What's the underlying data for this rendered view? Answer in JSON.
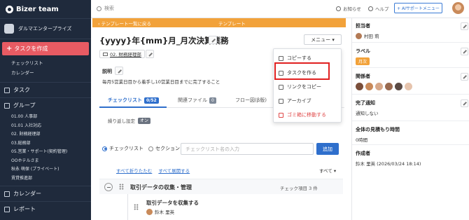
{
  "app": {
    "name": "Bizer team"
  },
  "sidebar": {
    "org_name": "ダルマエンタープライズ",
    "create_task_label": "タスクを作成",
    "sub_items": [
      "チェックリスト",
      "カレンダー"
    ],
    "tasks_label": "タスク",
    "groups_label": "グループ",
    "groups": [
      "01.00 人事部",
      "01.01 入社対応",
      "02. 財務経理部",
      "03.総務部",
      "05.営業・サポート(契約管理)",
      "OOホテルさま",
      "秋永 萌保 (プライベート)",
      "賃貸推進部"
    ],
    "calendar_label": "カレンダー",
    "report_label": "レポート"
  },
  "topbar": {
    "search_placeholder": "検索",
    "notifications_label": "お知らせ",
    "help_label": "ヘルプ",
    "ai_support_label": "+ AIサポートメニュー"
  },
  "banner": {
    "back_label": "テンプレート一覧に戻る",
    "title": "テンプレート"
  },
  "main": {
    "title": "{yyyy}年{mm}月_月次決算業務",
    "menu_label": "メニュー",
    "department": "02. 財務経理部",
    "description_label": "説明",
    "description": "毎月5営業日目から着手し10営業日目までに完了すること",
    "tabs": [
      {
        "label": "チェックリスト",
        "count": "0/52"
      },
      {
        "label": "関連ファイル",
        "count": "0"
      },
      {
        "label": "フロー図(β版)",
        "count": ""
      }
    ],
    "repeat_label": "繰り返し設定",
    "repeat_value": "オン",
    "radio_checklist": "チェックリスト",
    "radio_section": "セクション",
    "checklist_placeholder": "チェックリスト名の入力",
    "add_label": "追加",
    "collapse_all": "すべて折りたたむ",
    "expand_all": "すべて展開する",
    "all_select": "すべて",
    "group": {
      "title": "取引データの収集・管理",
      "count": "チェック項目 3 件"
    },
    "item": {
      "title": "取引データを収集する",
      "assignee": "鈴木 里英"
    }
  },
  "dropdown": {
    "items": [
      "コピーする",
      "タスクを作る",
      "リンクをコピー",
      "アーカイブ",
      "ゴミ箱に移動する"
    ]
  },
  "right_panel": {
    "owner_label": "担当者",
    "owner_value": "村田 莉",
    "label_label": "ラベル",
    "label_badge": "月次",
    "related_label": "関係者",
    "completion_label": "完了通知",
    "completion_value": "通知しない",
    "estimate_label": "全体の見積もり時間",
    "estimate_value": "0時間",
    "creator_label": "作成者",
    "creator_value": "鈴木 里英 (2026/03/24 18:14)"
  },
  "colors": {
    "sidebar": "#1f2a3c",
    "accent": "#2f6fcc",
    "create": "#e85b63",
    "banner": "#f2a23a",
    "highlight": "#e02020"
  }
}
